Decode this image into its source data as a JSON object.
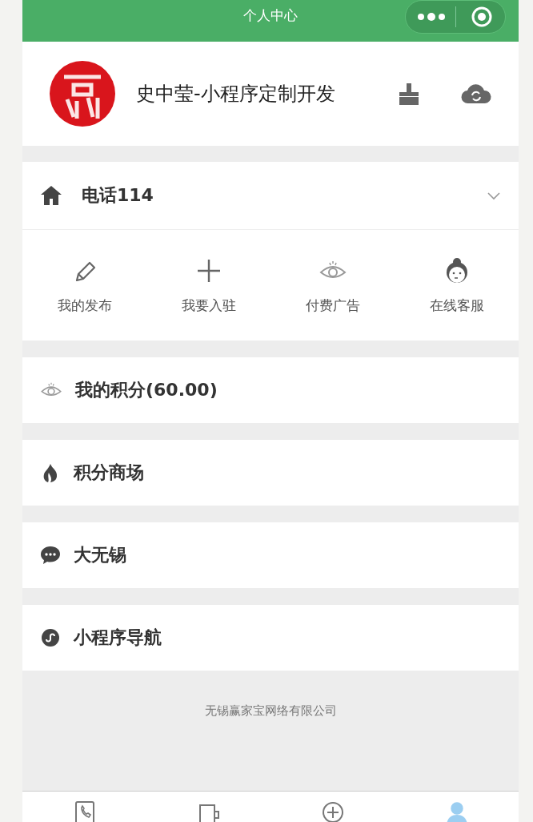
{
  "header": {
    "title": "个人中心"
  },
  "profile": {
    "name": "史中莹-小程序定制开发"
  },
  "service_card": {
    "title": "电话114",
    "expanded": false,
    "actions": [
      {
        "label": "我的发布",
        "kind": "pencil"
      },
      {
        "label": "我要入驻",
        "kind": "plus"
      },
      {
        "label": "付费广告",
        "kind": "eye"
      },
      {
        "label": "在线客服",
        "kind": "agent"
      }
    ]
  },
  "menu": [
    {
      "label": "我的积分(60.00)",
      "kind": "eye"
    },
    {
      "label": "积分商场",
      "kind": "fire"
    },
    {
      "label": "大无锡",
      "kind": "chat"
    },
    {
      "label": "小程序导航",
      "kind": "mini"
    }
  ],
  "footer": "无锡赢家宝网络有限公司",
  "tab_bar": [
    {
      "kind": "phone",
      "selected": false
    },
    {
      "kind": "wallet",
      "selected": false
    },
    {
      "kind": "add",
      "selected": false
    },
    {
      "kind": "user",
      "selected": true
    }
  ]
}
